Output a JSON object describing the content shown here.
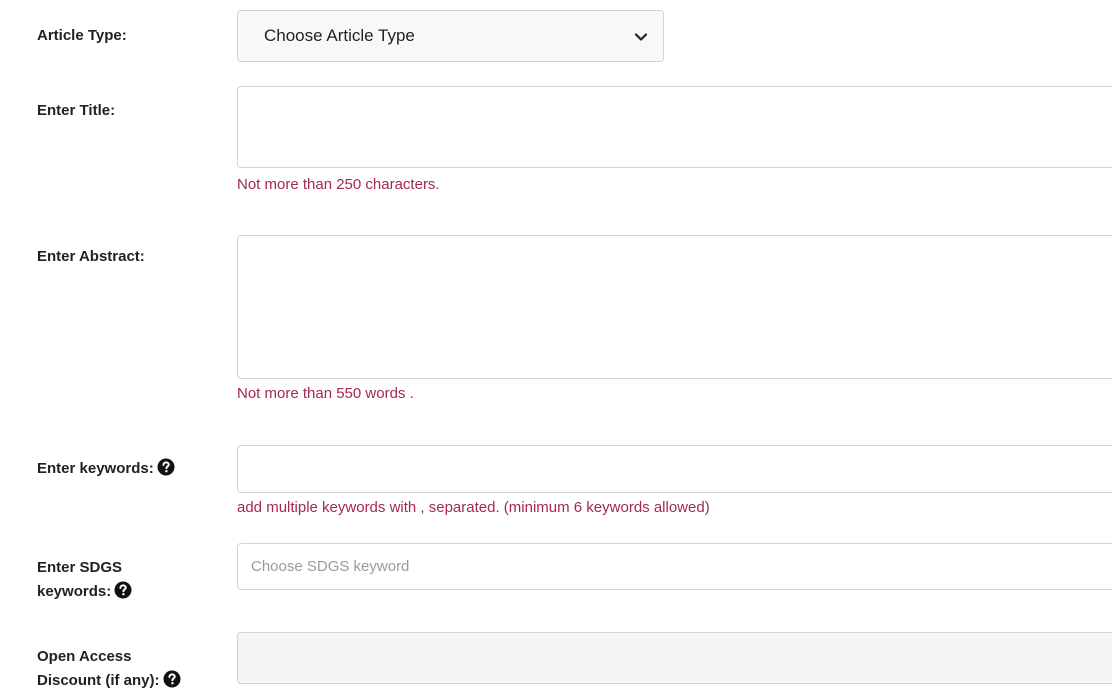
{
  "article_type": {
    "label": "Article Type:",
    "selected": "Choose Article Type"
  },
  "title": {
    "label": "Enter Title:",
    "hint": "Not more than 250 characters."
  },
  "abstract": {
    "label": "Enter Abstract:",
    "hint": "Not more than 550 words ."
  },
  "keywords": {
    "label": "Enter keywords:",
    "hint": "add multiple keywords with , separated. (minimum 6 keywords allowed)"
  },
  "sdgs": {
    "label_line1": "Enter SDGS",
    "label_line2": "keywords:",
    "placeholder": "Choose SDGS keyword"
  },
  "open_access": {
    "label_line1": "Open Access",
    "label_line2": "Discount (if any):"
  },
  "icons": {
    "help": "question-circle-icon",
    "dropdown": "chevron-down-icon"
  },
  "colors": {
    "hint": "#a32a4b",
    "border": "#d4d4d4"
  }
}
